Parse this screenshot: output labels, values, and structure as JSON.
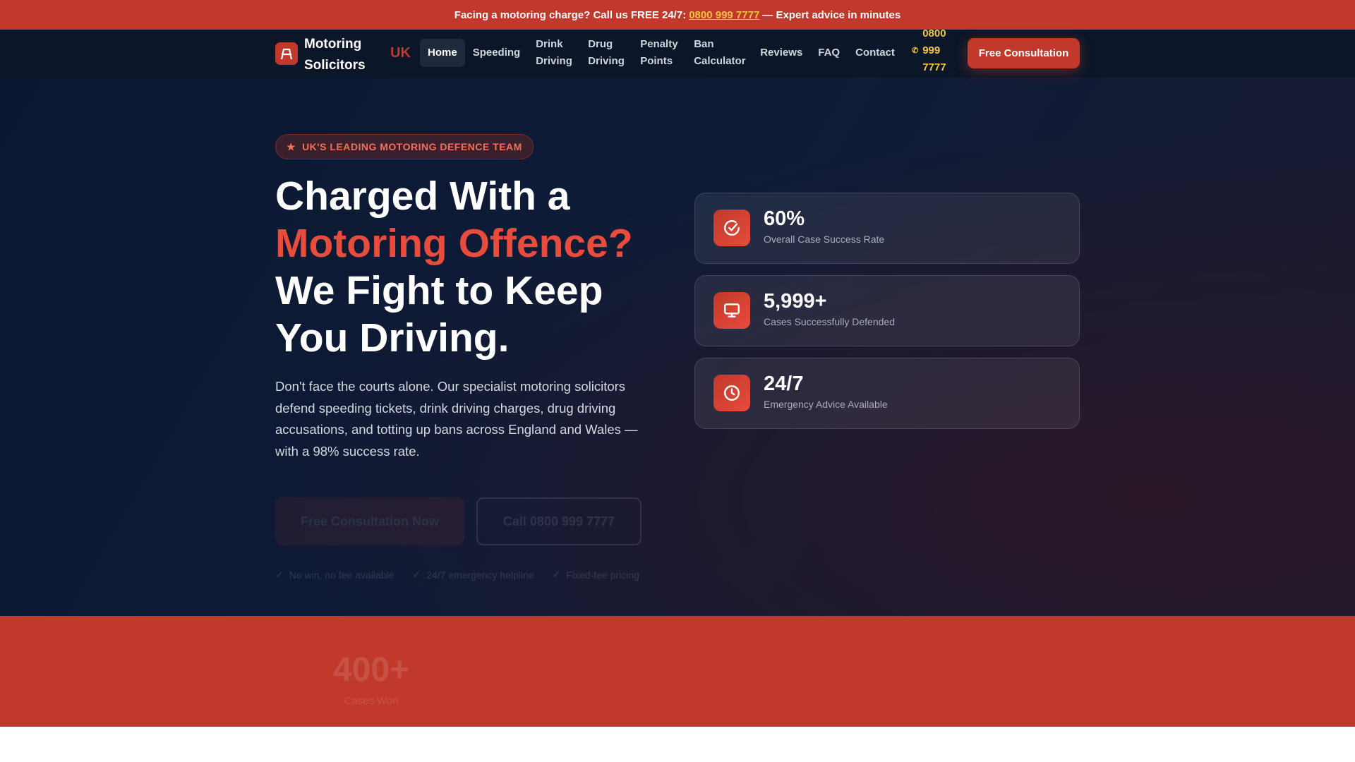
{
  "topbar": {
    "text_before": "Facing a motoring charge? Call us FREE 24/7:",
    "phone": "0800 999 7777",
    "text_after": "— Expert advice in minutes"
  },
  "nav": {
    "brand": "Motoring Solicitors",
    "brand_suffix": "UK",
    "links": [
      "Home",
      "Speeding",
      "Drink Driving",
      "Drug Driving",
      "Penalty Points",
      "Ban Calculator",
      "Reviews",
      "FAQ",
      "Contact"
    ],
    "phone": "0800 999 7777",
    "cta": "Free Consultation"
  },
  "hero": {
    "badge": "UK'S LEADING MOTORING DEFENCE TEAM",
    "title_1": "Charged With a",
    "title_red": "Motoring Offence?",
    "title_2": "We Fight to Keep You Driving.",
    "paragraph": "Don't face the courts alone. Our specialist motoring solicitors defend speeding tickets, drink driving charges, drug driving accusations, and totting up bans across England and Wales — with a 98% success rate.",
    "primary_button": "Free Consultation Now",
    "secondary_button": "Call 0800 999 7777",
    "checks": [
      "No win, no fee available",
      "24/7 emergency helpline",
      "Fixed-fee pricing"
    ]
  },
  "stats": [
    {
      "icon": "check-circle-icon",
      "value": "60%",
      "label": "Overall Case Success Rate"
    },
    {
      "icon": "monitor-icon",
      "value": "5,999+",
      "label": "Cases Successfully Defended"
    },
    {
      "icon": "clock-icon",
      "value": "24/7",
      "label": "Emergency Advice Available"
    }
  ],
  "counter": {
    "value": "400+",
    "label": "Cases Won"
  },
  "colors": {
    "brand": "#c0392b",
    "accent": "#f4c542",
    "navy": "#0b1628"
  }
}
